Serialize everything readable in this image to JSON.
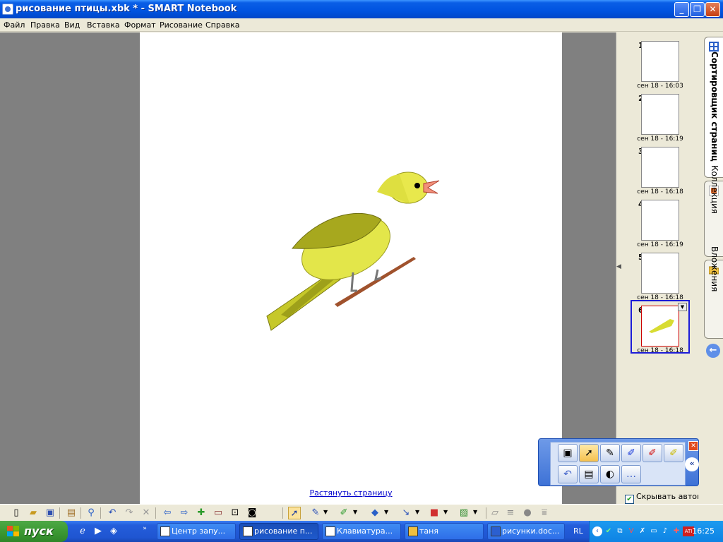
{
  "window": {
    "title": "рисование птицы.xbk * - SMART Notebook"
  },
  "menu": [
    "Файл",
    "Правка",
    "Вид",
    "Вставка",
    "Формат",
    "Рисование",
    "Справка"
  ],
  "page": {
    "stretch_link": "Растянуть страницу"
  },
  "sidebar": {
    "tabs": {
      "sorter": "Сортировщик страниц",
      "gallery": "Коллекция",
      "attachments": "Вложения"
    },
    "thumbnails": [
      {
        "num": "1",
        "time": "сен 18 - 16:03"
      },
      {
        "num": "2",
        "time": "сен 18 - 16:19"
      },
      {
        "num": "3",
        "time": "сен 18 - 16:18"
      },
      {
        "num": "4",
        "time": "сен 18 - 16:19"
      },
      {
        "num": "5",
        "time": "сен 18 - 16:18"
      },
      {
        "num": "6",
        "time": "сен 18 - 16:18"
      }
    ],
    "autohide_label": "Скрывать автома",
    "autohide_checked": true
  },
  "floating_tools": [
    "screen-capture-icon",
    "select-icon",
    "magic-pen-icon",
    "blue-pen-icon",
    "red-pen-icon",
    "highlighter-icon",
    "undo-icon",
    "eraser-icon",
    "mouse-icon",
    "more-tools-icon"
  ],
  "taskbar": {
    "start_label": "пуск",
    "tasks": [
      "Центр запу...",
      "рисование п...",
      "Клавиатура...",
      "таня",
      "рисунки.doc..."
    ],
    "language": "RL",
    "clock": "16:25"
  },
  "colors": {
    "title_bar": "#0053e0",
    "taskbar": "#245edb",
    "start_button": "#3c9a33",
    "workspace": "#808080",
    "selected_thumb_border": "#1c1cd8",
    "bird_yellow": "#dbe13a"
  }
}
